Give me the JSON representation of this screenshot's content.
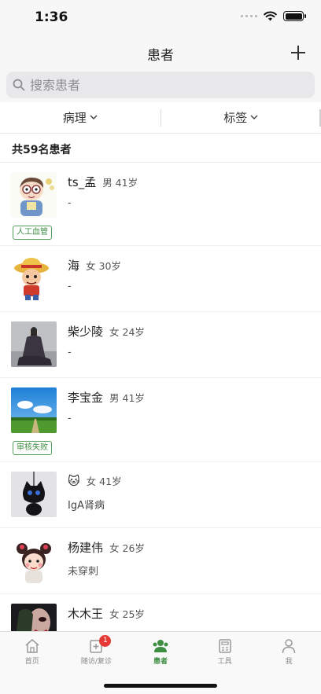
{
  "status_bar": {
    "time": "1:36"
  },
  "header": {
    "title": "患者"
  },
  "search": {
    "placeholder": "搜索患者"
  },
  "filters": [
    {
      "label": "病理"
    },
    {
      "label": "标签"
    }
  ],
  "summary": {
    "count_text": "共59名患者"
  },
  "patients": [
    {
      "name": "ts_孟",
      "gender_age": "男 41岁",
      "diagnosis": "-",
      "tag": "人工血管",
      "avatar": "cartoon-boy-avatar"
    },
    {
      "name": "海",
      "gender_age": "女 30岁",
      "diagnosis": "-",
      "tag": "",
      "avatar": "straw-hat-cartoon-avatar"
    },
    {
      "name": "柴少陵",
      "gender_age": "女 24岁",
      "diagnosis": "-",
      "tag": "",
      "avatar": "photo-person-avatar"
    },
    {
      "name": "李宝金",
      "gender_age": "男 41岁",
      "diagnosis": "-",
      "tag": "审核失败",
      "avatar": "landscape-avatar"
    },
    {
      "name": "🐱",
      "gender_age": "女 41岁",
      "diagnosis": "IgA肾病",
      "tag": "",
      "avatar": "black-cat-charm-avatar"
    },
    {
      "name": "杨建伟",
      "gender_age": "女 26岁",
      "diagnosis": "未穿刺",
      "tag": "",
      "avatar": "cartoon-girl-avatar"
    },
    {
      "name": "木木王",
      "gender_age": "女 25岁",
      "diagnosis": "",
      "tag": "",
      "avatar": "dark-photo-avatar"
    }
  ],
  "tabs": [
    {
      "label": "首页",
      "icon": "home-icon",
      "active": false
    },
    {
      "label": "随访/复诊",
      "icon": "followup-icon",
      "badge": "1",
      "active": false
    },
    {
      "label": "患者",
      "icon": "patients-icon",
      "active": true
    },
    {
      "label": "工具",
      "icon": "tools-icon",
      "active": false
    },
    {
      "label": "我",
      "icon": "profile-icon",
      "active": false
    }
  ],
  "colors": {
    "accent": "#3e8e41",
    "badge": "#e53935",
    "tag_border": "#55a05a"
  }
}
